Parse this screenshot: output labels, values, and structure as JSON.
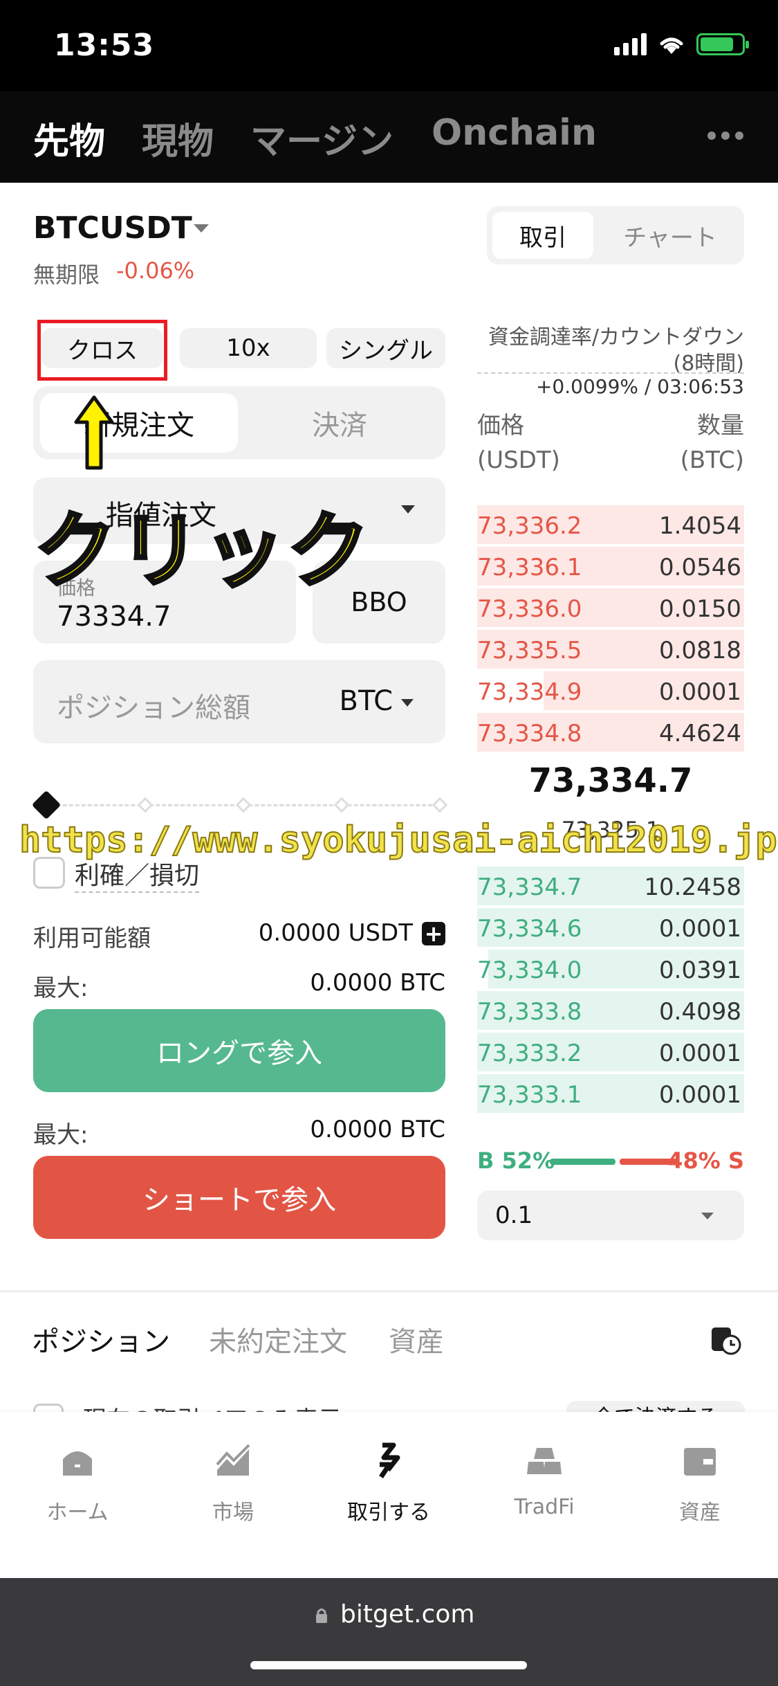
{
  "status_bar": {
    "time": "13:53"
  },
  "top_nav": {
    "tabs": [
      "先物",
      "現物",
      "マージン",
      "Onchain"
    ]
  },
  "symbol": {
    "name": "BTCUSDT",
    "contract_label": "無期限",
    "change": "-0.06%"
  },
  "view_switch": {
    "trade": "取引",
    "chart": "チャート"
  },
  "modes": {
    "margin": "クロス",
    "leverage": "10x",
    "position": "シングル"
  },
  "order_tabs": {
    "open": "新規注文",
    "close": "決済"
  },
  "order_form": {
    "type": "指値注文",
    "price_label": "価格",
    "price_value": "73334.7",
    "bbo": "BBO",
    "amount_placeholder": "ポジション総額",
    "amount_unit": "BTC",
    "tpsl": "利確／損切",
    "available_label": "利用可能額",
    "available_value": "0.0000 USDT",
    "max_label": "最大:",
    "max_long": "0.0000 BTC",
    "max_short": "0.0000 BTC",
    "long_button": "ロングで参入",
    "short_button": "ショートで参入"
  },
  "funding": {
    "title": "資金調達率/カウントダウン",
    "period": "(8時間)",
    "value": "+0.0099% / 03:06:53"
  },
  "order_book": {
    "price_header_1": "価格",
    "price_header_2": "(USDT)",
    "qty_header_1": "数量",
    "qty_header_2": "(BTC)",
    "asks": [
      {
        "price": "73,336.2",
        "qty": "1.4054"
      },
      {
        "price": "73,336.1",
        "qty": "0.0546"
      },
      {
        "price": "73,336.0",
        "qty": "0.0150"
      },
      {
        "price": "73,335.5",
        "qty": "0.0818"
      },
      {
        "price": "73,334.9",
        "qty": "0.0001"
      },
      {
        "price": "73,334.8",
        "qty": "4.4624"
      }
    ],
    "last_price": "73,334.7",
    "mark_price": "73,325.1",
    "bids": [
      {
        "price": "73,334.7",
        "qty": "10.2458"
      },
      {
        "price": "73,334.6",
        "qty": "0.0001"
      },
      {
        "price": "73,334.0",
        "qty": "0.0391"
      },
      {
        "price": "73,333.8",
        "qty": "0.4098"
      },
      {
        "price": "73,333.2",
        "qty": "0.0001"
      },
      {
        "price": "73,333.1",
        "qty": "0.0001"
      }
    ],
    "buy_ratio": "B 52%",
    "sell_ratio": "48% S",
    "depth": "0.1"
  },
  "bottom_tabs": [
    "ポジション",
    "未約定注文",
    "資産"
  ],
  "partial_row": {
    "text": "現在の取引ペアのみ表示",
    "button": "全て決済する"
  },
  "bottom_nav": [
    "ホーム",
    "市場",
    "取引する",
    "TradFi",
    "資産"
  ],
  "browser": {
    "url": "bitget.com"
  },
  "annotations": {
    "click_text": "クリック",
    "watermark": "https://www.syokujusai-aichi2019.jp/"
  },
  "colors": {
    "long": "#55b88e",
    "short": "#e25545",
    "ask_text": "#e55646",
    "bid_text": "#3fae80",
    "highlight_box": "#ea1c24",
    "annotation_yellow": "#fff200"
  }
}
